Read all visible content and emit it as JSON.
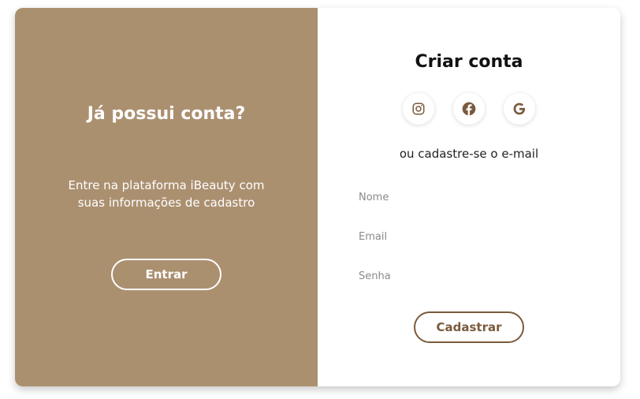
{
  "colors": {
    "accent": "#ab9070",
    "brown": "#7a5a3c",
    "white": "#ffffff"
  },
  "login_panel": {
    "title": "Já possui conta?",
    "description": "Entre na plataforma iBeauty com suas informações de cadastro",
    "button_label": "Entrar"
  },
  "signup_panel": {
    "title": "Criar conta",
    "social_icons": [
      "instagram-icon",
      "facebook-icon",
      "google-icon"
    ],
    "subtitle": "ou cadastre-se o e-mail",
    "fields": {
      "name_placeholder": "Nome",
      "email_placeholder": "Email",
      "password_placeholder": "Senha"
    },
    "button_label": "Cadastrar"
  }
}
